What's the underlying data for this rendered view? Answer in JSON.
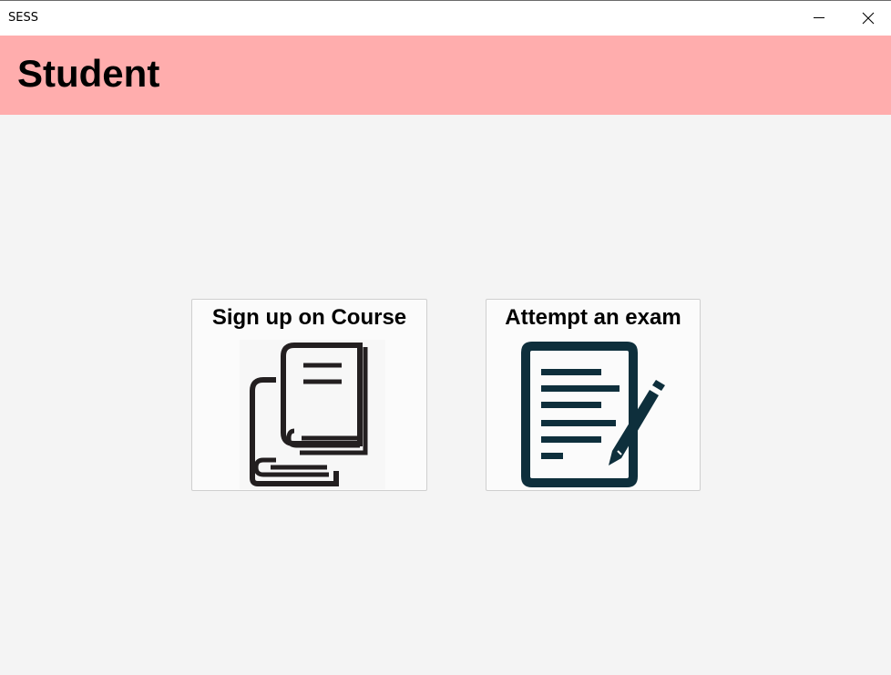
{
  "window": {
    "title": "SESS",
    "minimize_icon": "minimize-icon",
    "close_icon": "close-icon"
  },
  "header": {
    "title": "Student",
    "background": "#ffadad"
  },
  "tiles": [
    {
      "label": "Sign up on Course",
      "icon": "books-icon"
    },
    {
      "label": "Attempt an exam",
      "icon": "exam-document-pencil-icon"
    }
  ],
  "colors": {
    "books_icon": "#231f20",
    "exam_icon": "#0e2f3c"
  }
}
